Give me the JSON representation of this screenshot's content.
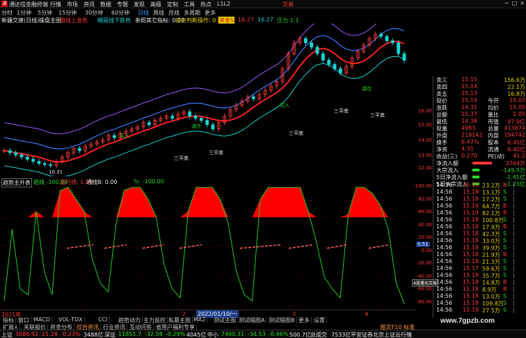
{
  "app": {
    "title": "通达信金融终端",
    "top_right": "交易"
  },
  "menu": [
    "行情",
    "市场",
    "资讯",
    "数据",
    "专题",
    "发现",
    "高级",
    "定制",
    "工具",
    "热点",
    "L1L2"
  ],
  "periods": [
    "分时",
    "1分钟",
    "5分钟",
    "15分钟",
    "30分钟",
    "60分钟",
    "日线",
    "周线",
    "月线",
    "多周期",
    "更多"
  ],
  "active_period": "日线",
  "infobar": {
    "stock": "新疆交建(日线)",
    "formula": "操盘主图",
    "item1": "粗线上涨色",
    "item2": "细是线下跌色",
    "item3": "参照其它指标: 0.00",
    "item4": "综合判断操作: 0.00",
    "item5": "资金S",
    "val1": "16.27",
    "val2": "16.27",
    "val3": "压力:1:18"
  },
  "chart_labels": {
    "bottoms": [
      "三平底",
      "三平底",
      "三平底",
      "三平底",
      "三平底"
    ],
    "signals": [
      "买入",
      "减仓",
      "买入",
      "减仓"
    ],
    "low": "10.31"
  },
  "main_axis": [
    "16.00",
    "15.00",
    "14.00",
    "13.00",
    "12.00"
  ],
  "sub_axis": [
    "100.00",
    "80.00",
    "60.00",
    "40.00",
    "20.00",
    "0.00",
    "-20.00",
    "-40.00",
    "-60.00",
    "-80.00"
  ],
  "sub_indicator": {
    "name": "趋势主升表",
    "a": "趋线 -100.00",
    "b": "运行线: 1.00",
    "c": "通线B: 0.00",
    "d": "%: -100.00",
    "marker_right": "0.51",
    "tooltip": "A股量化交易"
  },
  "quote": [
    {
      "label": "卖三",
      "price": "15.15",
      "vol": "156.6万"
    },
    {
      "label": "卖四",
      "price": "15.14",
      "vol": "22.1万"
    },
    {
      "label": "卖五",
      "price": "15.13",
      "vol": "16.8万"
    },
    {
      "label": "现价",
      "price": "15.19",
      "l2": "今开",
      "v2": "15.03"
    },
    {
      "label": "涨跌",
      "price": "14.31",
      "l2": "均价",
      "v2": "15.05"
    },
    {
      "label": "总额",
      "price": "15.37",
      "l2": "量比",
      "v2": "1.05"
    },
    {
      "label": "最低",
      "price": "14.38",
      "l2": "市值",
      "v2": "97.9亿"
    },
    {
      "label": "现量",
      "price": "4983",
      "l2": "总量",
      "v2": "413874"
    },
    {
      "label": "外盘",
      "price": "219142",
      "l2": "内盘",
      "v2": "194742"
    },
    {
      "label": "换手",
      "price": "6.47%",
      "l2": "股本",
      "v2": "6.45亿"
    },
    {
      "label": "净资",
      "price": "4.31",
      "l2": "流通",
      "v2": "6.40亿"
    },
    {
      "label": "收益(三)",
      "price": "0.270",
      "l2": "PE(动)",
      "v2": "41.2"
    }
  ],
  "flows": [
    {
      "label": "净流入额",
      "value": "3764万",
      "cls": "red"
    },
    {
      "label": "大宗流入",
      "value": "-149.5万",
      "cls": "green"
    },
    {
      "label": "5日净流入额",
      "value": "-1.41亿",
      "cls": "green"
    },
    {
      "label": "5日大宗流入",
      "value": "-1.23亿",
      "cls": "green"
    }
  ],
  "ticks": [
    {
      "t": "14:56",
      "p": "15.19",
      "v": "23.2万",
      "s": "B"
    },
    {
      "t": "14:56",
      "p": "15.18",
      "v": "13.1万",
      "s": "S"
    },
    {
      "t": "14:56",
      "p": "15.18",
      "v": "17.2万",
      "s": "S"
    },
    {
      "t": "14:56",
      "p": "15.19",
      "v": "64.7万",
      "s": "B"
    },
    {
      "t": "14:56",
      "p": "15.19",
      "v": "82.1万",
      "s": "B"
    },
    {
      "t": "14:56",
      "p": "15.18",
      "v": "100.8万",
      "s": "S"
    },
    {
      "t": "14:56",
      "p": "15.18",
      "v": "17.9万",
      "s": "B"
    },
    {
      "t": "14:56",
      "p": "15.18",
      "v": "42.3万",
      "s": "S"
    },
    {
      "t": "14:56",
      "p": "15.18",
      "v": "33.0万",
      "s": "S"
    },
    {
      "t": "14:56",
      "p": "15.18",
      "v": "39.9万",
      "s": "S"
    },
    {
      "t": "14:56",
      "p": "15.18",
      "v": "21.9万",
      "s": "B"
    },
    {
      "t": "14:56",
      "p": "15.18",
      "v": "21.3万",
      "s": "S"
    },
    {
      "t": "14:56",
      "p": "15.17",
      "v": "59.6万",
      "s": "S"
    },
    {
      "t": "14:56",
      "p": "15.18",
      "v": "35.7万",
      "s": "S"
    },
    {
      "t": "14:56",
      "p": "15.18",
      "v": "14.8万",
      "s": "B"
    },
    {
      "t": "14:56",
      "p": "15.18",
      "v": "8.9万",
      "s": "B"
    },
    {
      "t": "14:56",
      "p": "15.18",
      "v": "13.0万",
      "s": "S"
    },
    {
      "t": "14:56",
      "p": "15.18",
      "v": "109.8万",
      "s": "S"
    },
    {
      "t": "14:56",
      "p": "15.18",
      "v": "27.5万",
      "s": "S"
    }
  ],
  "timeaxis": {
    "year": "2021年",
    "cursor": "2022/01/10/一",
    "m2": "2",
    "m3": "3",
    "m4": "4"
  },
  "tabs": [
    "指标",
    "窗口",
    "MACD",
    "VOL-TDX",
    "CCI",
    "趋势动力",
    "主力监控",
    "私募主图",
    "MA2",
    "测试主图",
    "测试幅图A",
    "测试幅图B",
    "更多",
    "设置"
  ],
  "tabs2": [
    "扩展∧",
    "关联报价",
    "资金分布",
    "综合资讯",
    "行业资讯",
    "互动问答",
    "省用户福利专享"
  ],
  "tabs2_right": "图文F10 标准",
  "status": [
    {
      "label": "上证",
      "v": "3086.92",
      "c": "21.28",
      "p": "0.23%",
      "a": "3488亿"
    },
    {
      "label": "深证",
      "v": "11851.7",
      "c": "-32.58",
      "p": "-0.29%",
      "a": "4045亿"
    },
    {
      "label": "中小",
      "v": "7490.31",
      "c": "-34.53",
      "p": "-0.46%",
      "a": "500.7亿"
    }
  ],
  "status_extra": "总成交",
  "status_amt": "7533亿",
  "status_right": "平安证券北京上证云行情",
  "watermark": "www.7gpzb.com",
  "chart_data": {
    "type": "line",
    "title": "新疆交建(日线)",
    "ylim": [
      10,
      16.7
    ],
    "candles_close": [
      11.0,
      10.9,
      10.8,
      10.7,
      10.6,
      10.5,
      10.4,
      10.35,
      10.31,
      10.5,
      10.7,
      10.9,
      11.1,
      11.0,
      11.2,
      11.3,
      11.4,
      11.5,
      11.7,
      11.6,
      11.8,
      11.9,
      12.0,
      12.1,
      12.3,
      12.2,
      12.4,
      12.5,
      12.6,
      12.5,
      12.7,
      12.8,
      12.6,
      12.5,
      12.4,
      12.2,
      12.0,
      12.3,
      12.6,
      12.9,
      13.1,
      13.3,
      13.5,
      13.4,
      13.6,
      13.8,
      14.0,
      14.2,
      14.8,
      15.5,
      16.0,
      16.2,
      16.0,
      15.8,
      15.5,
      15.2,
      15.0,
      14.8,
      14.6,
      14.9,
      15.3,
      15.6,
      15.9,
      16.2,
      16.4,
      16.3,
      16.1,
      16.0,
      15.5,
      15.19
    ],
    "sub_series": [
      -90,
      30,
      -70,
      -80,
      60,
      -40,
      -80,
      95,
      100,
      80,
      60,
      -20,
      -60,
      -75,
      40,
      95,
      100,
      100,
      80,
      50,
      -30,
      -70,
      -85,
      60,
      100,
      100,
      100,
      80,
      40,
      -40,
      -80,
      -90,
      80,
      100,
      100,
      100,
      100,
      100,
      60,
      10,
      -50,
      -70,
      -85,
      55,
      100,
      100,
      90,
      70,
      30,
      -60,
      -95
    ]
  }
}
